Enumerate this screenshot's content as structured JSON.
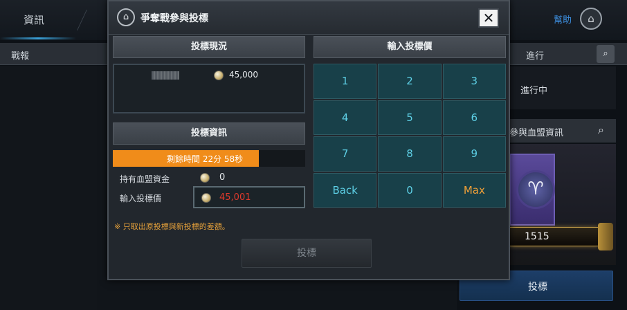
{
  "background": {
    "tabs": [
      "資訊"
    ],
    "subheader": "戰報",
    "help_label": "幫助",
    "right_header_label": "進行",
    "right_status": "進行中",
    "right_sub_label": "參與血盟資訊",
    "score": "1515",
    "bid_button_label": "投標"
  },
  "modal": {
    "title": "爭奪戰參與投標",
    "close_symbol": "✕",
    "bid_status_header": "投標現況",
    "current_bid": {
      "amount": "45,000"
    },
    "bid_info_header": "投標資訊",
    "remaining_time": "剩餘時間 22分 58秒",
    "remaining_fraction": 0.76,
    "clan_funds_label": "持有血盟資金",
    "clan_funds_value": "0",
    "bid_input_label": "輸入投標價",
    "bid_input_value": "45,001",
    "note": "※ 只取出原投標與新投標的差額。",
    "submit_label": "投標",
    "keypad_header": "輸入投標價",
    "keypad": [
      "1",
      "2",
      "3",
      "4",
      "5",
      "6",
      "7",
      "8",
      "9",
      "Back",
      "0",
      "Max"
    ]
  },
  "colors": {
    "accent_key_text": "#5ed0e6",
    "max_key_text": "#f0a038",
    "progress_fill": "#f08c1a",
    "bid_value_text": "#e03a2c",
    "note_text": "#e8a23a"
  }
}
